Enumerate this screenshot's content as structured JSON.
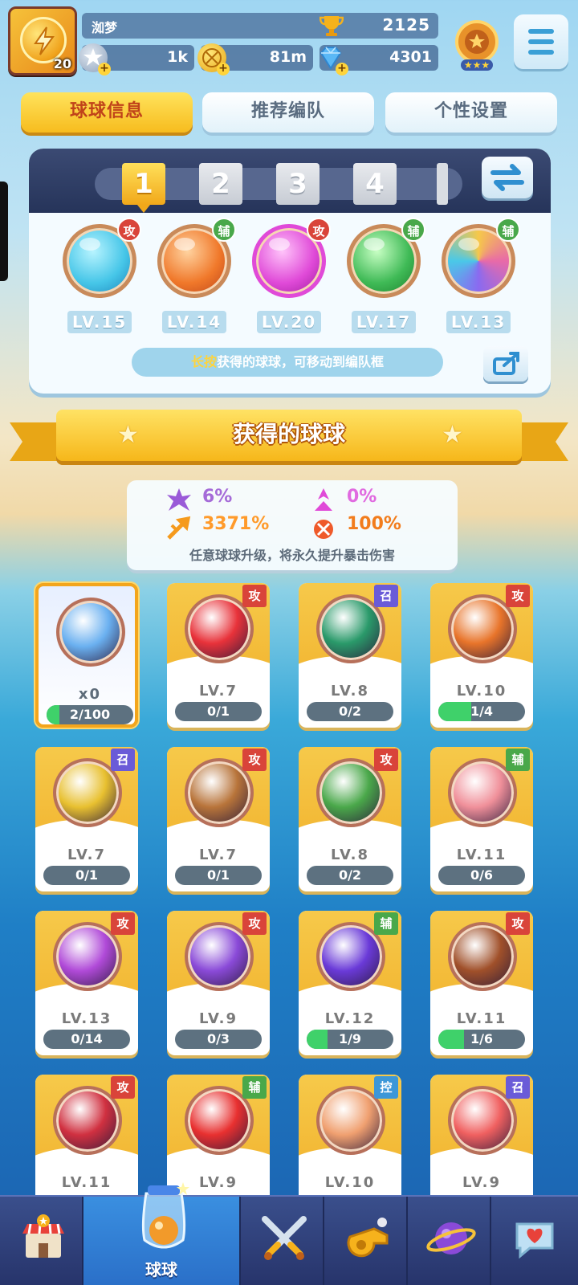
{
  "player": {
    "name": "洳梦",
    "level": "20",
    "trophies": "2125"
  },
  "resources": [
    {
      "name": "star-currency",
      "value": "1k"
    },
    {
      "name": "gold-coin",
      "value": "81m"
    },
    {
      "name": "diamond",
      "value": "4301"
    }
  ],
  "tabs": [
    {
      "label": "球球信息",
      "active": true
    },
    {
      "label": "推荐编队",
      "active": false
    },
    {
      "label": "个性设置",
      "active": false
    }
  ],
  "team": {
    "slots": [
      "1",
      "2",
      "3",
      "4"
    ],
    "selected_slot": "1",
    "balls": [
      {
        "type": "攻",
        "level": "LV.15",
        "color": "#46c6e8"
      },
      {
        "type": "辅",
        "level": "LV.14",
        "color": "#f0782a"
      },
      {
        "type": "攻",
        "level": "LV.20",
        "color": "#e04ad8"
      },
      {
        "type": "辅",
        "level": "LV.17",
        "color": "#3fba56"
      },
      {
        "type": "辅",
        "level": "LV.13",
        "color": "#e8b84a"
      }
    ],
    "hint_highlight": "长按",
    "hint_text": "获得的球球，可移动到编队框"
  },
  "section_title": "获得的球球",
  "stats": {
    "crit_rate": "6%",
    "crit_rate_2": "0%",
    "crit_damage": "3371%",
    "crit_damage_2": "100%",
    "note": "任意球球升级，将永久提升暴击伤害"
  },
  "owned_balls": [
    {
      "special": true,
      "level": "x0",
      "progress": "2/100",
      "fill": 0.02,
      "color": "#6ab0f0"
    },
    {
      "type": "攻",
      "level": "LV.7",
      "progress": "0/1",
      "fill": 0,
      "color": "#e8323a"
    },
    {
      "type": "召",
      "level": "LV.8",
      "progress": "0/2",
      "fill": 0,
      "color": "#2a9a6a"
    },
    {
      "type": "攻",
      "level": "LV.10",
      "progress": "1/4",
      "fill": 0.25,
      "color": "#e8742a"
    },
    {
      "type": "召",
      "level": "LV.7",
      "progress": "0/1",
      "fill": 0,
      "color": "#e8c030"
    },
    {
      "type": "攻",
      "level": "LV.7",
      "progress": "0/1",
      "fill": 0,
      "color": "#b8743a"
    },
    {
      "type": "攻",
      "level": "LV.8",
      "progress": "0/2",
      "fill": 0,
      "color": "#4aa84a"
    },
    {
      "type": "辅",
      "level": "LV.11",
      "progress": "0/6",
      "fill": 0,
      "color": "#f0909a"
    },
    {
      "type": "攻",
      "level": "LV.13",
      "progress": "0/14",
      "fill": 0,
      "color": "#b04ad8"
    },
    {
      "type": "攻",
      "level": "LV.9",
      "progress": "0/3",
      "fill": 0,
      "color": "#8a4ad8"
    },
    {
      "type": "辅",
      "level": "LV.12",
      "progress": "1/9",
      "fill": 0.11,
      "color": "#6a3ad8"
    },
    {
      "type": "攻",
      "level": "LV.11",
      "progress": "1/6",
      "fill": 0.17,
      "color": "#a0502a"
    },
    {
      "type": "攻",
      "level": "LV.11",
      "progress": "",
      "fill": 0,
      "color": "#d03040"
    },
    {
      "type": "辅",
      "level": "LV.9",
      "progress": "",
      "fill": 0,
      "color": "#e83030"
    },
    {
      "type": "控",
      "level": "LV.10",
      "progress": "",
      "fill": 0,
      "color": "#f0a070"
    },
    {
      "type": "召",
      "level": "LV.9",
      "progress": "",
      "fill": 0,
      "color": "#f06060"
    }
  ],
  "nav": [
    {
      "name": "shop",
      "label": ""
    },
    {
      "name": "balls",
      "label": "球球",
      "active": true
    },
    {
      "name": "battle",
      "label": ""
    },
    {
      "name": "whistle",
      "label": ""
    },
    {
      "name": "planet",
      "label": ""
    },
    {
      "name": "social",
      "label": ""
    }
  ]
}
